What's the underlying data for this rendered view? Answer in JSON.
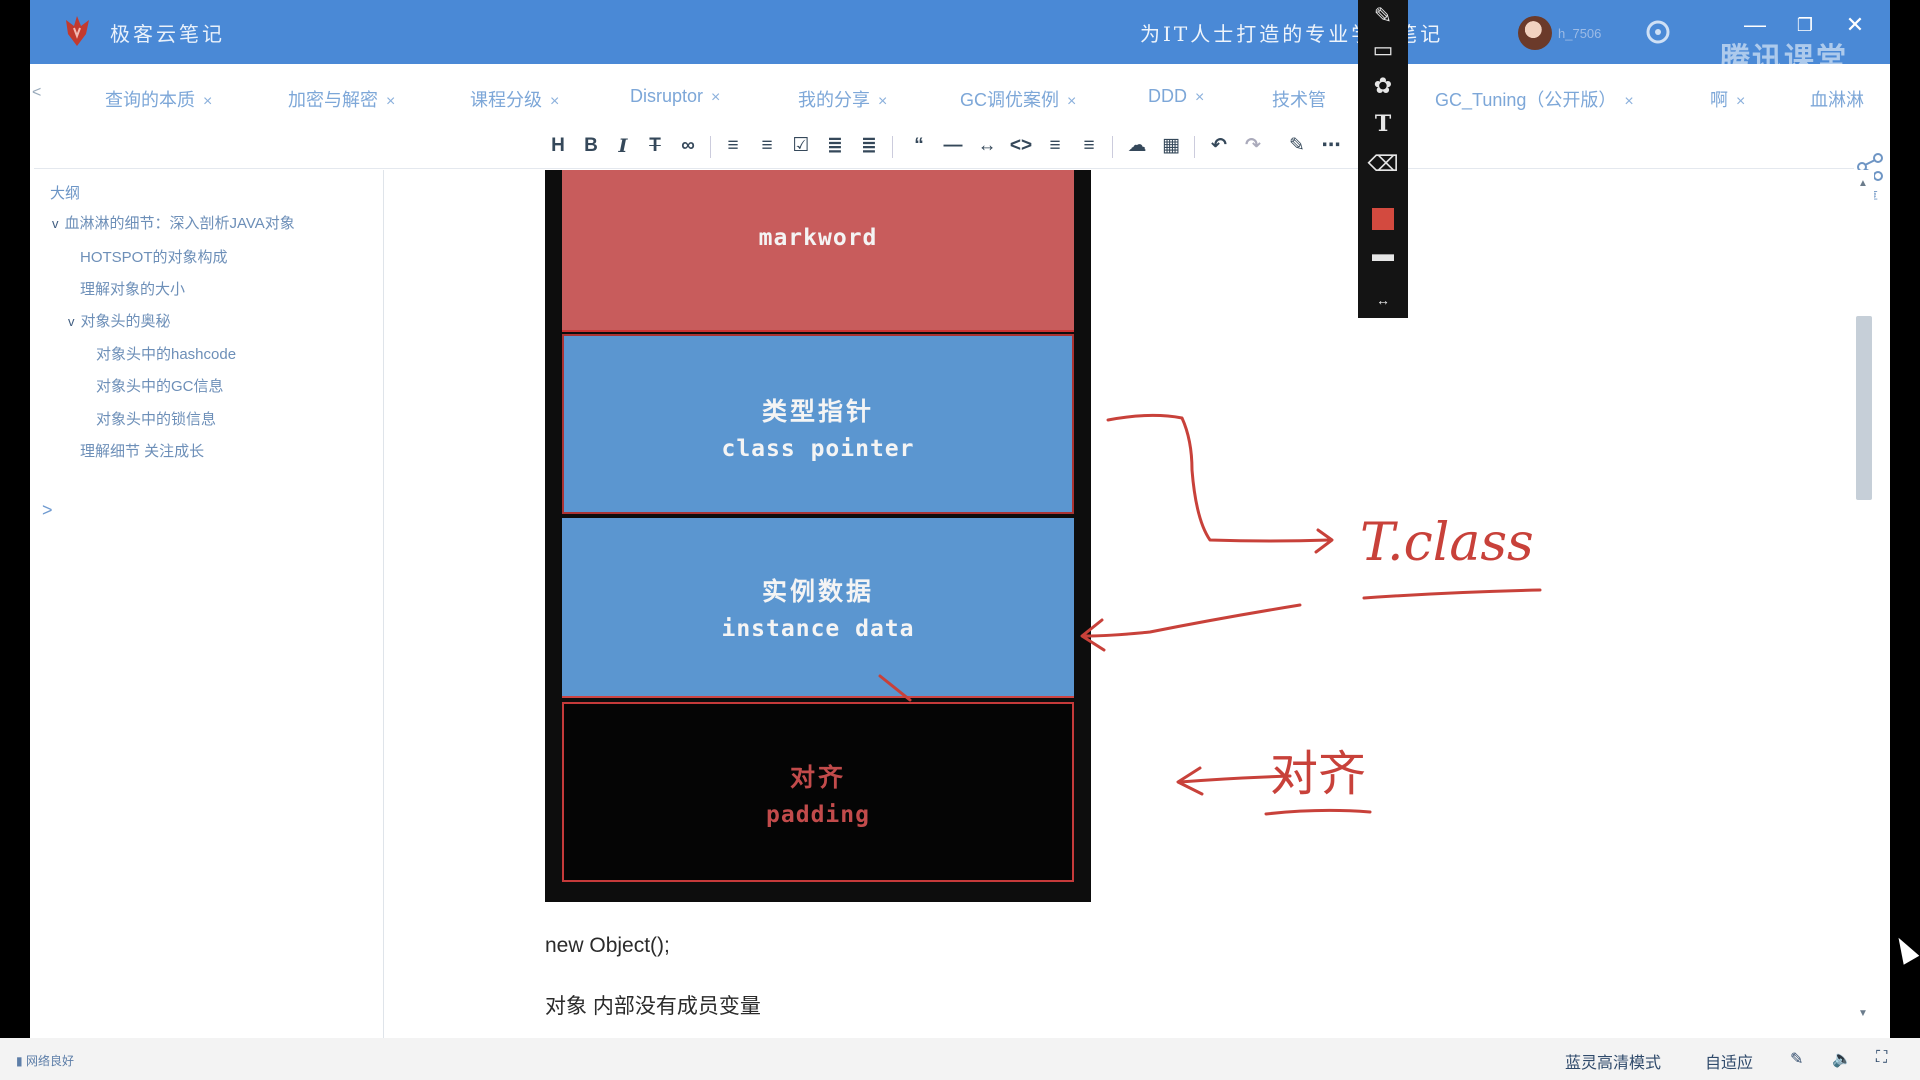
{
  "app": {
    "title": "极客云笔记",
    "slogan": "为IT人士打造的专业学习笔记",
    "username": "h_7506",
    "watermark": "腾讯课堂"
  },
  "tabs": [
    {
      "label": "查询的本质",
      "close": "×"
    },
    {
      "label": "加密与解密",
      "close": "×"
    },
    {
      "label": "课程分级",
      "close": "×"
    },
    {
      "label": "Disruptor",
      "close": "×"
    },
    {
      "label": "我的分享",
      "close": "×"
    },
    {
      "label": "GC调优案例",
      "close": "×"
    },
    {
      "label": "DDD",
      "close": "×"
    },
    {
      "label": "技术管",
      "close": ""
    },
    {
      "label": "GC_Tuning（公开版）",
      "close": "×"
    },
    {
      "label": "啊",
      "close": "×"
    },
    {
      "label": "血淋淋",
      "close": ""
    }
  ],
  "outline": {
    "title": "大纲",
    "items": [
      {
        "label": "血淋淋的细节：深入剖析JAVA对象",
        "caret": "v"
      },
      {
        "label": "HOTSPOT的对象构成",
        "caret": ""
      },
      {
        "label": "理解对象的大小",
        "caret": ""
      },
      {
        "label": "对象头的奥秘",
        "caret": "v"
      },
      {
        "label": "对象头中的hashcode",
        "caret": ""
      },
      {
        "label": "对象头中的GC信息",
        "caret": ""
      },
      {
        "label": "对象头中的锁信息",
        "caret": ""
      },
      {
        "label": "理解细节 关注成长",
        "caret": ""
      }
    ],
    "expand": ">"
  },
  "diagram": {
    "markword": "markword",
    "pointer_zh": "类型指针",
    "pointer_en": "class pointer",
    "data_zh": "实例数据",
    "data_en": "instance data",
    "padding_zh": "对齐",
    "padding_en": "padding"
  },
  "annotations": {
    "t_class": "T.class",
    "align": "对齐"
  },
  "document": {
    "code": "new Object();",
    "paragraph": "对象 内部没有成员变量"
  },
  "share": {
    "label": "分享"
  },
  "player": {
    "network": "网络良好",
    "quality": "蓝灵高清模式",
    "fit": "自适应"
  },
  "colors": {
    "titlebar": "#4a89d6",
    "markword": "#c85c5c",
    "blue_block": "#5b96d0",
    "annotation_ink": "#c8413a"
  }
}
